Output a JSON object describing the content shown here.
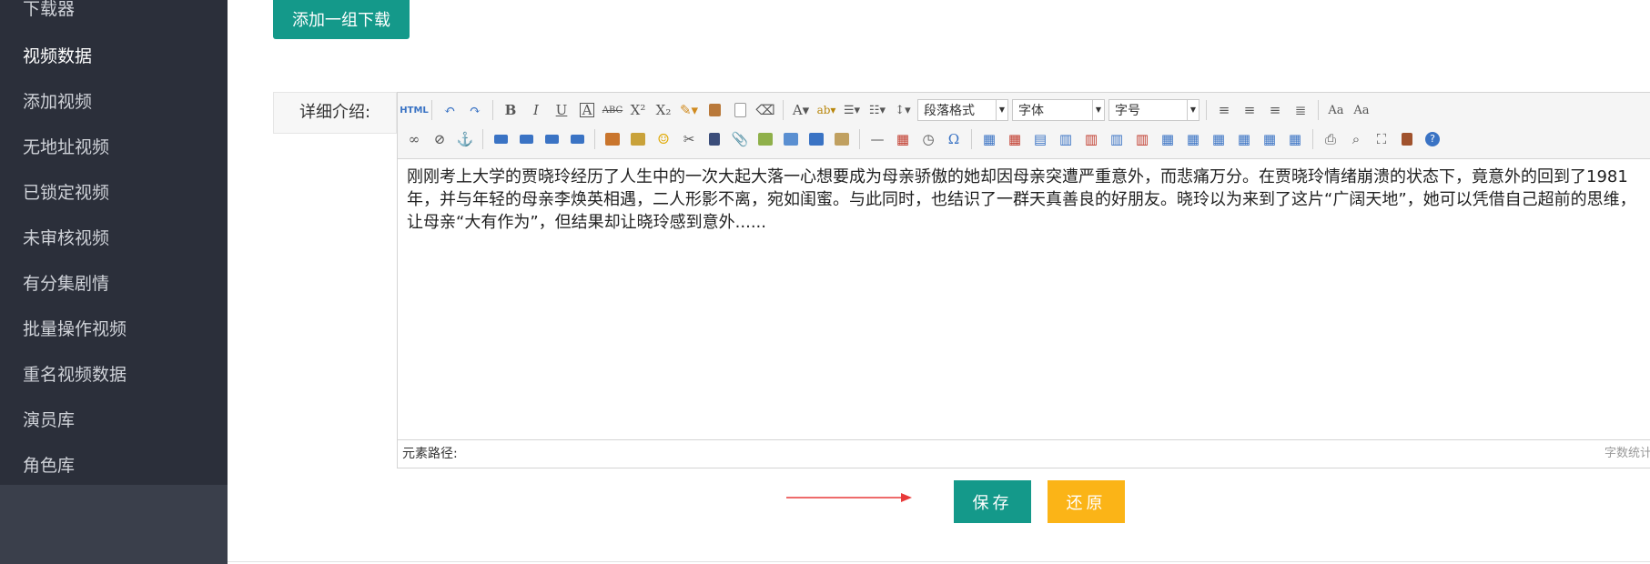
{
  "sidebar": {
    "items": [
      {
        "label": "下载器"
      },
      {
        "label": "视频数据"
      },
      {
        "label": "添加视频"
      },
      {
        "label": "无地址视频"
      },
      {
        "label": "已锁定视频"
      },
      {
        "label": "未审核视频"
      },
      {
        "label": "有分集剧情"
      },
      {
        "label": "批量操作视频"
      },
      {
        "label": "重名视频数据"
      },
      {
        "label": "演员库"
      },
      {
        "label": "角色库"
      }
    ]
  },
  "main": {
    "add_group_label": "添加一组下载",
    "detail_label": "详细介绍:",
    "editor": {
      "toolbar": {
        "html_label": "HTML",
        "bold": "B",
        "italic": "I",
        "underline": "U",
        "paragraph_format": "段落格式",
        "font_family": "字体",
        "font_size": "字号"
      },
      "content": "刚刚考上大学的贾晓玲经历了人生中的一次大起大落一心想要成为母亲骄傲的她却因母亲突遭严重意外，而悲痛万分。在贾晓玲情绪崩溃的状态下，竟意外的回到了1981年，并与年轻的母亲李焕英相遇，二人形影不离，宛如闺蜜。与此同时，也结识了一群天真善良的好朋友。晓玲以为来到了这片“广阔天地”，她可以凭借自己超前的思维，让母亲“大有作为”，但结果却让晓玲感到意外......",
      "status_path_label": "元素路径:",
      "word_count_label": "字数统计"
    },
    "save_label": "保存",
    "reset_label": "还原"
  },
  "colors": {
    "sidebar_bg": "#2b2f3a",
    "primary": "#14998a",
    "warning": "#fbb417",
    "annotation_arrow": "#e83a3a"
  }
}
